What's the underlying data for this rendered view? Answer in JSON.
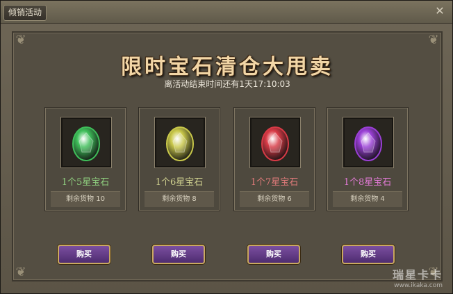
{
  "window": {
    "tab_label": "倾销活动",
    "close_label": "✕"
  },
  "panel": {
    "title": "限时宝石清仓大甩卖",
    "countdown": "离活动结束时间还有1天17:10:03"
  },
  "items": [
    {
      "name": "1个5星宝石",
      "stock": "剩余货物 10",
      "color": "#3fbf5a",
      "name_color": "#8fcf7f",
      "buy_label": "购买"
    },
    {
      "name": "1个6星宝石",
      "stock": "剩余货物 8",
      "color": "#c9c84a",
      "name_color": "#cfd08f",
      "buy_label": "购买"
    },
    {
      "name": "1个7星宝石",
      "stock": "剩余货物 6",
      "color": "#d83a46",
      "name_color": "#e07a7a",
      "buy_label": "购买"
    },
    {
      "name": "1个8星宝石",
      "stock": "剩余货物 4",
      "color": "#9a3fd6",
      "name_color": "#e27ad6",
      "buy_label": "购买"
    }
  ],
  "watermark": {
    "line1": "瑞星卡卡",
    "line2": "www.ikaka.com"
  }
}
